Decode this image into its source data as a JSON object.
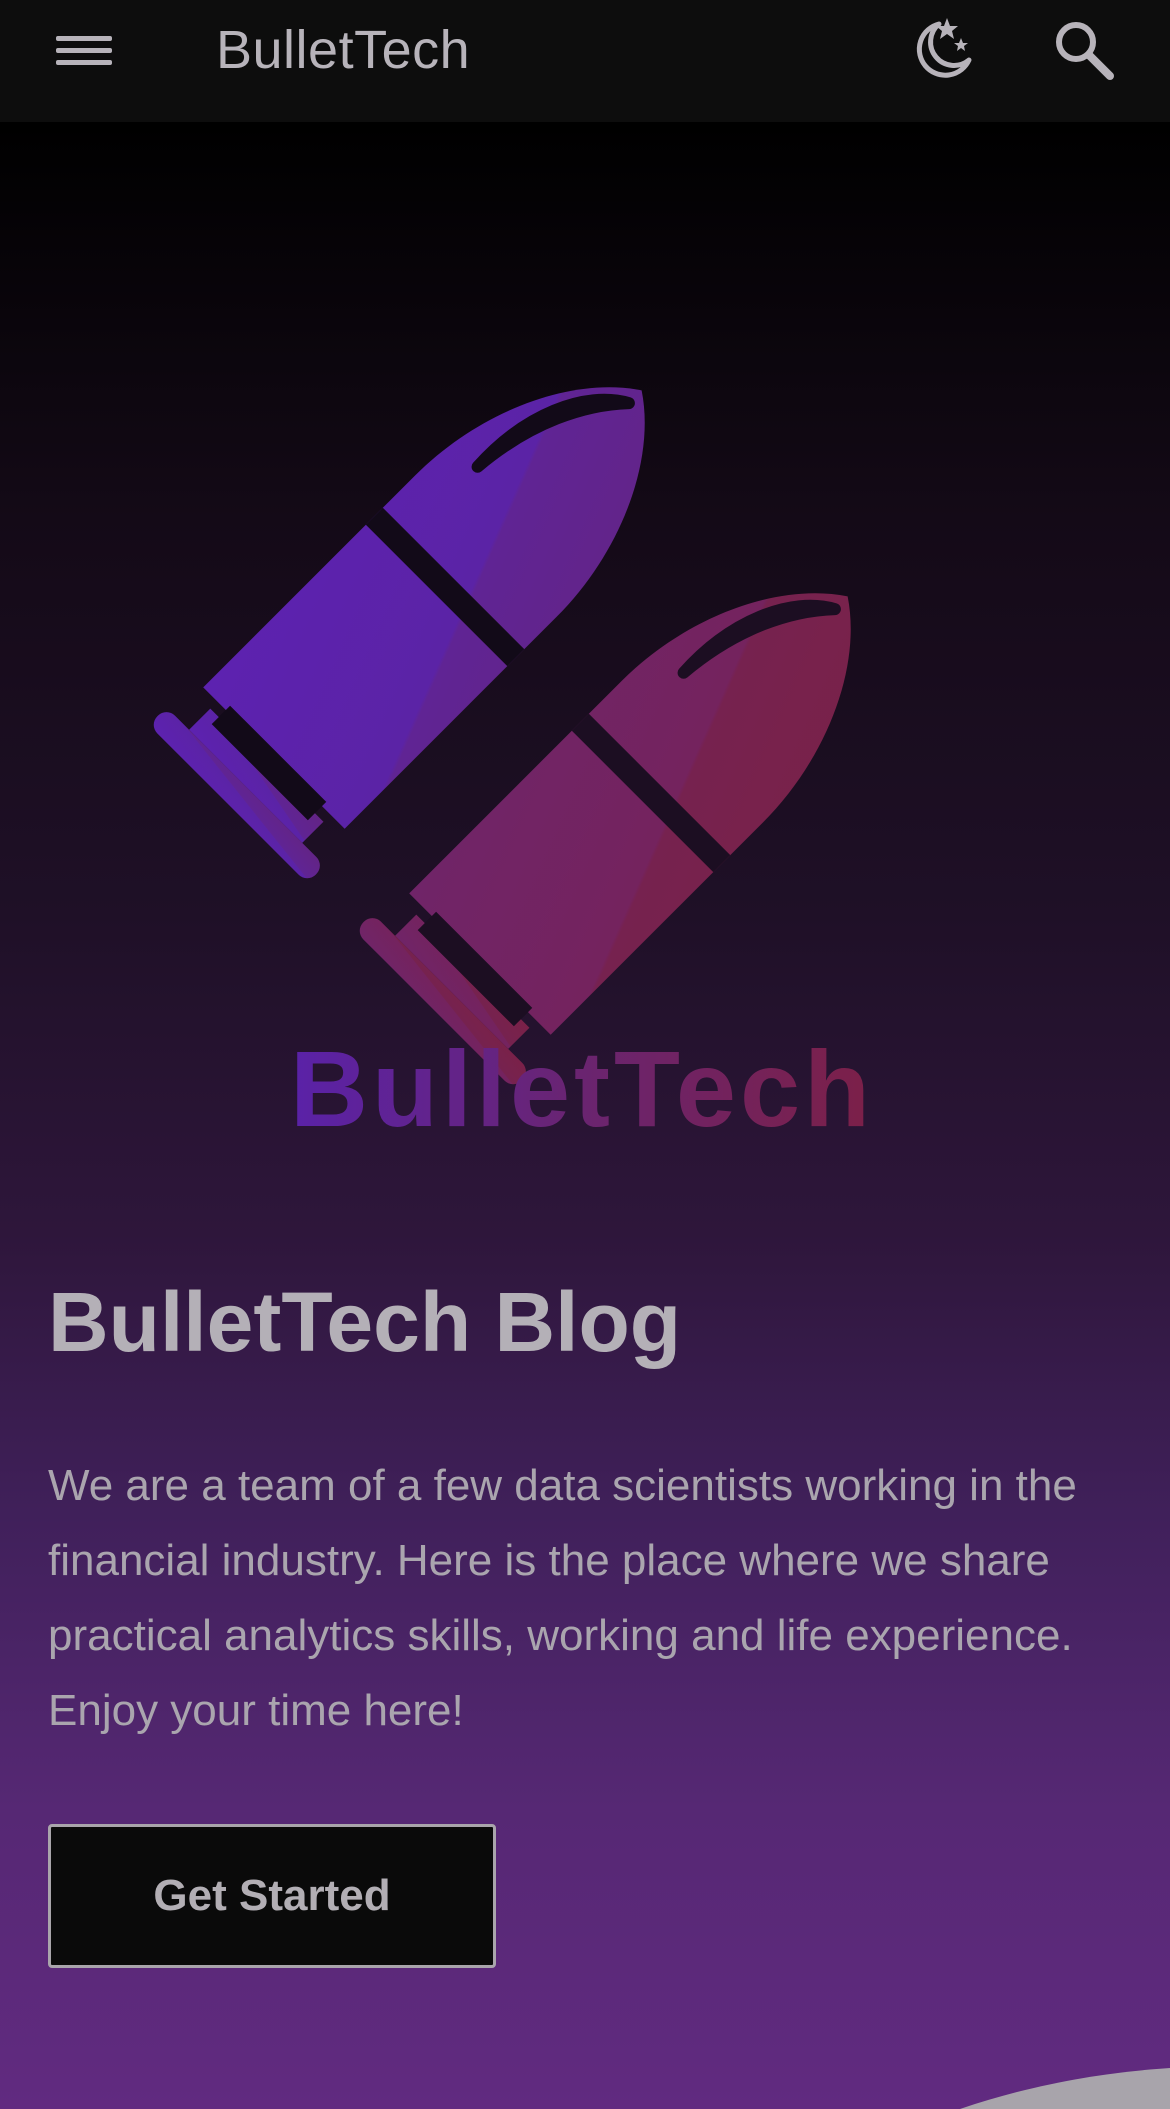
{
  "header": {
    "site_title": "BulletTech",
    "menu_icon": "hamburger-menu-icon",
    "theme_icon": "moon-stars-icon",
    "search_icon": "search-icon"
  },
  "logo": {
    "wordmark": "BulletTech",
    "colors": {
      "purple": "#5b24a8",
      "magenta": "#7a2150"
    }
  },
  "hero": {
    "title": "BulletTech Blog",
    "description": "We are a team of a few data scientists working in the financial industry. Here is the place where we share practical analytics skills, working and life experience. Enjoy your time here!",
    "cta_label": "Get Started"
  },
  "colors": {
    "topbar_bg": "#0d0d0d",
    "text_primary": "#b4b0b7",
    "gradient_bottom": "#612a80"
  }
}
